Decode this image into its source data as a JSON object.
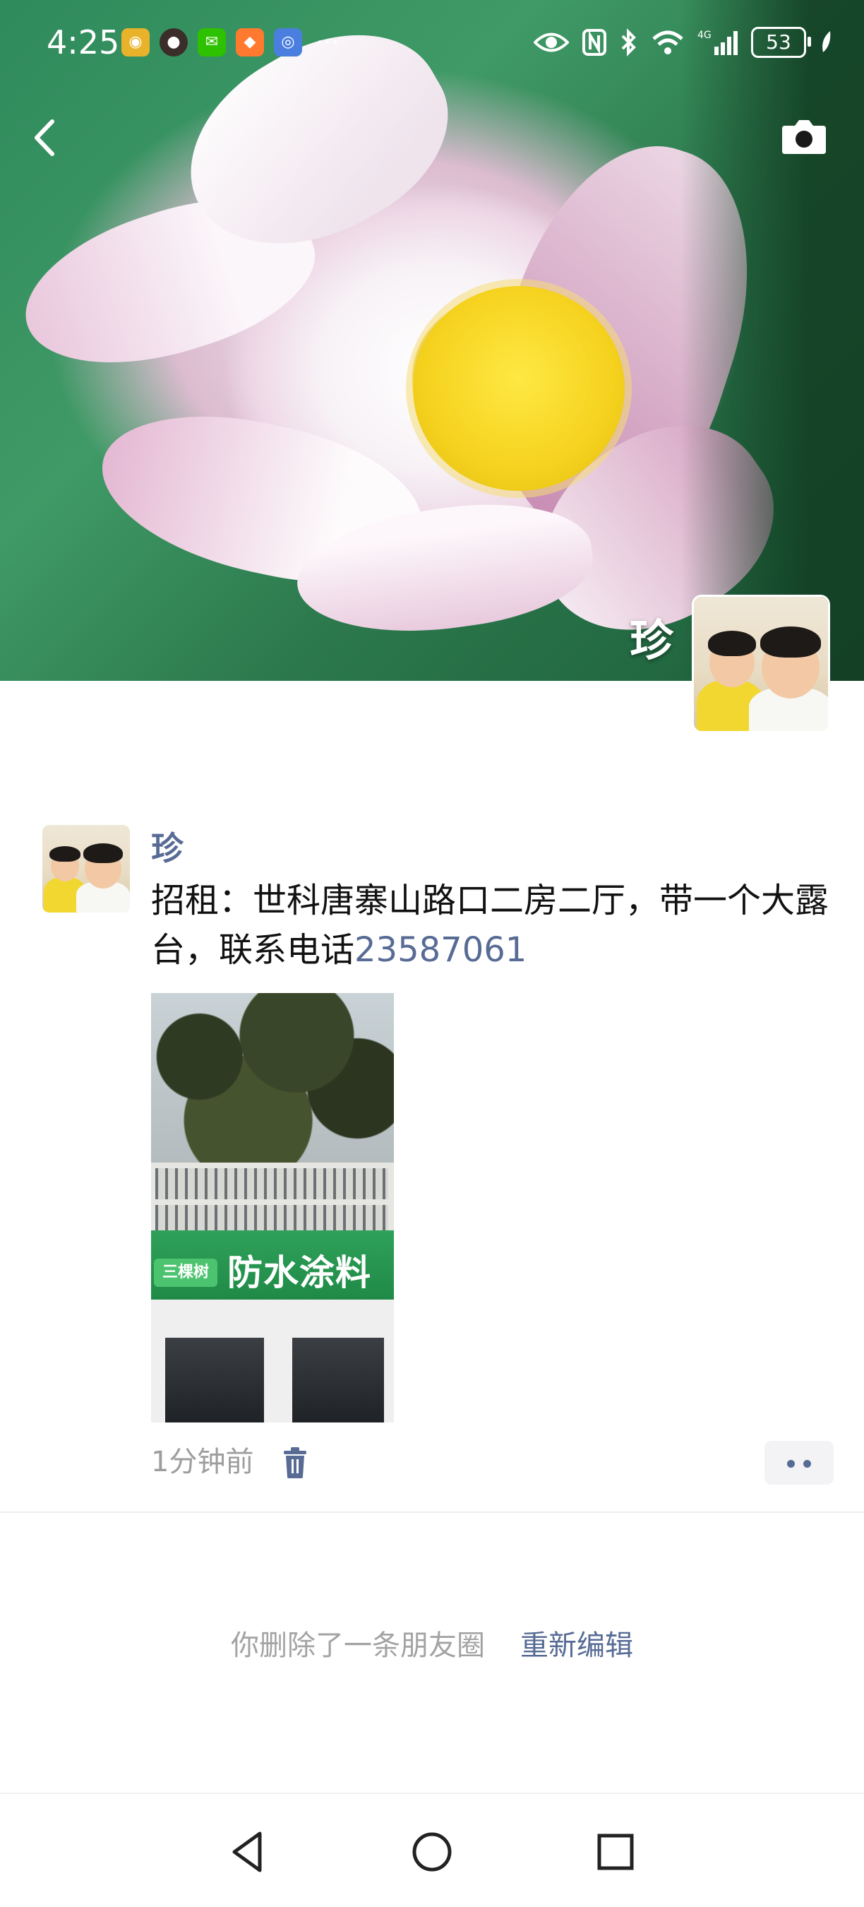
{
  "status_bar": {
    "time": "4:25",
    "battery": "53",
    "more_dots": "···",
    "notification_apps": [
      "weibo-icon",
      "contact-avatar-icon",
      "wechat-icon",
      "app-icon",
      "browser-icon"
    ],
    "system_icons": [
      "eye-icon",
      "nfc-icon",
      "bluetooth-icon",
      "wifi-icon",
      "4g-signal-icon",
      "battery-icon",
      "leaf-icon"
    ]
  },
  "header": {
    "back_icon": "chevron-left-icon",
    "camera_icon": "camera-icon",
    "owner_name": "珍"
  },
  "post": {
    "author": "珍",
    "text_before": "招租：世科唐寨山路口二房二厅，带一个大露台，联系电话",
    "phone": "23587061",
    "image_sign_small": "三棵树",
    "image_sign_text": "防水涂料",
    "time": "1分钟前",
    "trash_icon": "trash-icon",
    "more_icon": "more-dots-icon"
  },
  "notice": {
    "text": "你删除了一条朋友圈",
    "action": "重新编辑"
  },
  "navbar": {
    "back": "triangle-back-icon",
    "home": "circle-home-icon",
    "recents": "square-recents-icon"
  },
  "colors": {
    "link": "#576b95",
    "muted": "#9d9d9d"
  }
}
